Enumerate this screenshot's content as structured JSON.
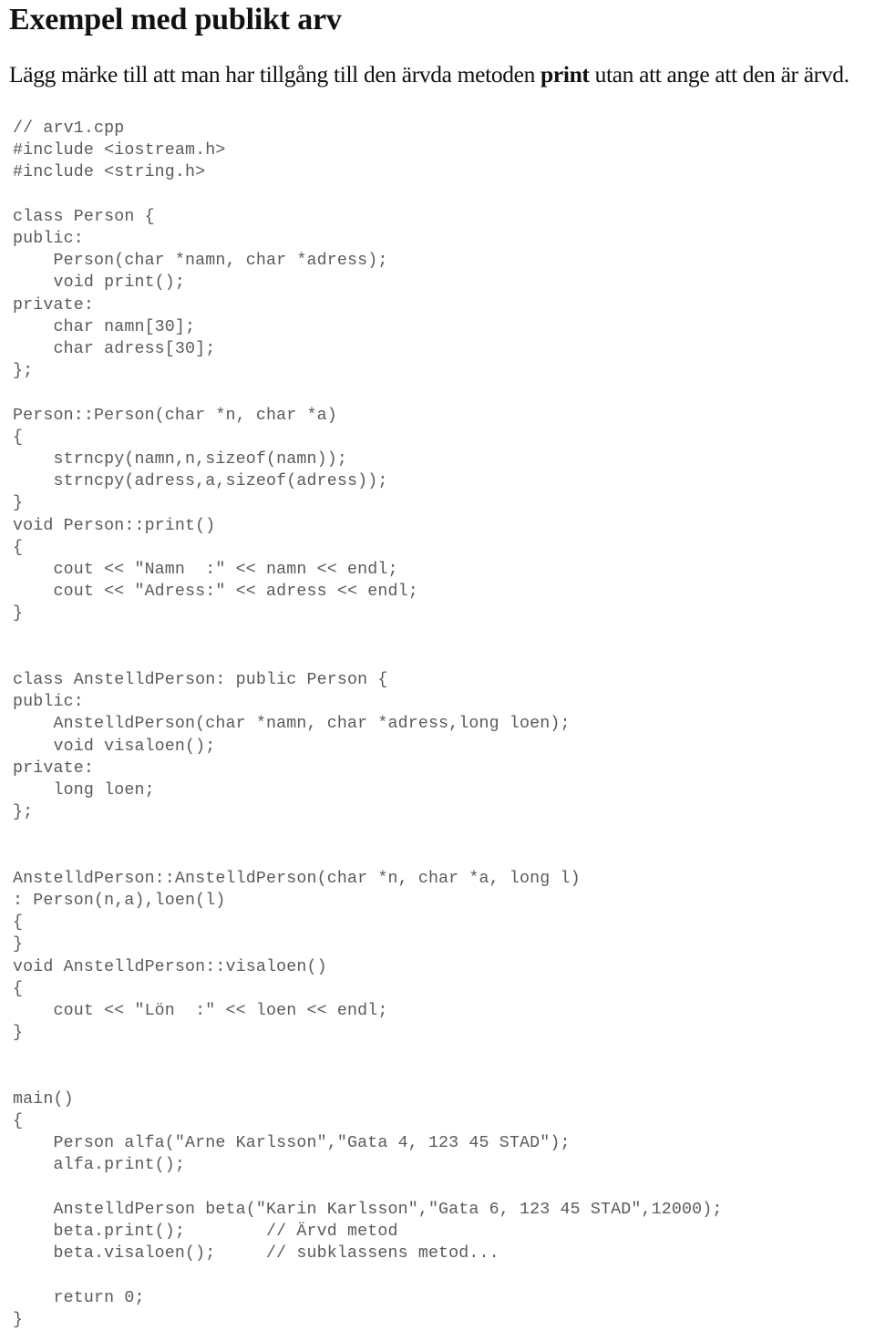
{
  "document": {
    "title": "Exempel med publikt arv",
    "intro": {
      "before": "Lägg märke till att man har tillgång till den ärvda metoden ",
      "keyword": "print",
      "after": " utan att ange att den är ärvd."
    },
    "code_language": "cpp",
    "code_lines": [
      "// arv1.cpp",
      "#include <iostream.h>",
      "#include <string.h>",
      "",
      "class Person {",
      "public:",
      "    Person(char *namn, char *adress);",
      "    void print();",
      "private:",
      "    char namn[30];",
      "    char adress[30];",
      "};",
      "",
      "Person::Person(char *n, char *a)",
      "{",
      "    strncpy(namn,n,sizeof(namn));",
      "    strncpy(adress,a,sizeof(adress));",
      "}",
      "void Person::print()",
      "{",
      "    cout << \"Namn  :\" << namn << endl;",
      "    cout << \"Adress:\" << adress << endl;",
      "}",
      "",
      "",
      "class AnstelldPerson: public Person {",
      "public:",
      "    AnstelldPerson(char *namn, char *adress,long loen);",
      "    void visaloen();",
      "private:",
      "    long loen;",
      "};",
      "",
      "",
      "AnstelldPerson::AnstelldPerson(char *n, char *a, long l)",
      ": Person(n,a),loen(l)",
      "{",
      "}",
      "void AnstelldPerson::visaloen()",
      "{",
      "    cout << \"Lön  :\" << loen << endl;",
      "}",
      "",
      "",
      "main()",
      "{",
      "    Person alfa(\"Arne Karlsson\",\"Gata 4, 123 45 STAD\");",
      "    alfa.print();",
      "",
      "    AnstelldPerson beta(\"Karin Karlsson\",\"Gata 6, 123 45 STAD\",12000);",
      "    beta.print();        // Ärvd metod",
      "    beta.visaloen();     // subklassens metod...",
      "",
      "    return 0;",
      "}"
    ]
  }
}
